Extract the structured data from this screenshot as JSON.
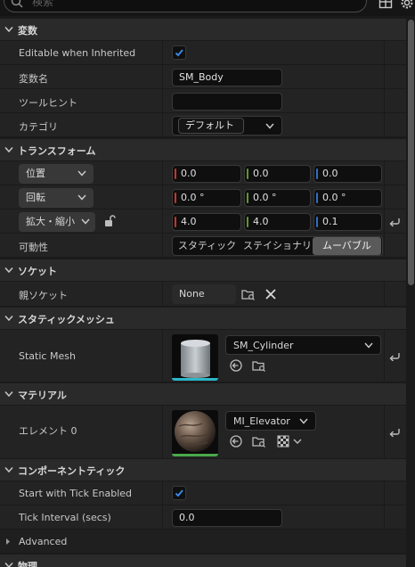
{
  "search": {
    "placeholder": "検索"
  },
  "categories": {
    "variable": "変数",
    "transform": "トランスフォーム",
    "socket": "ソケット",
    "static_mesh": "スタティックメッシュ",
    "materials": "マテリアル",
    "component_tick": "コンポーネントティック",
    "physics": "物理"
  },
  "variable": {
    "editable_label": "Editable when Inherited",
    "editable_checked": true,
    "name_label": "変数名",
    "name_value": "SM_Body",
    "tooltip_label": "ツールヒント",
    "tooltip_value": "",
    "category_label": "カテゴリ",
    "category_value": "デフォルト"
  },
  "transform": {
    "location_mode": "位置",
    "rotation_mode": "回転",
    "scale_mode": "拡大・縮小",
    "location": [
      "0.0",
      "0.0",
      "0.0"
    ],
    "rotation": [
      "0.0 °",
      "0.0 °",
      "0.0 °"
    ],
    "scale": [
      "4.0",
      "4.0",
      "0.1"
    ],
    "scale_locked": false,
    "mobility_label": "可動性",
    "mobility_options": [
      "スタティック",
      "ステイショナリ",
      "ムーバブル"
    ],
    "mobility_selected": "ムーバブル",
    "axis_colors": [
      "#c8332e",
      "#5b9a2a",
      "#2f6fc5"
    ]
  },
  "socket": {
    "parent_label": "親ソケット",
    "parent_value": "None"
  },
  "static_mesh": {
    "label": "Static Mesh",
    "value": "SM_Cylinder"
  },
  "materials": {
    "label": "エレメント 0",
    "value": "MI_Elevator"
  },
  "tick": {
    "start_label": "Start with Tick Enabled",
    "start_checked": true,
    "interval_label": "Tick Interval (secs)",
    "interval_value": "0.0",
    "advanced_label": "Advanced"
  },
  "colors": {
    "accent_blue": "#2f7fd8",
    "mesh_underline": "#2ab7c8",
    "material_underline": "#4aa84a",
    "selected_segment": "#5a5a5a"
  }
}
